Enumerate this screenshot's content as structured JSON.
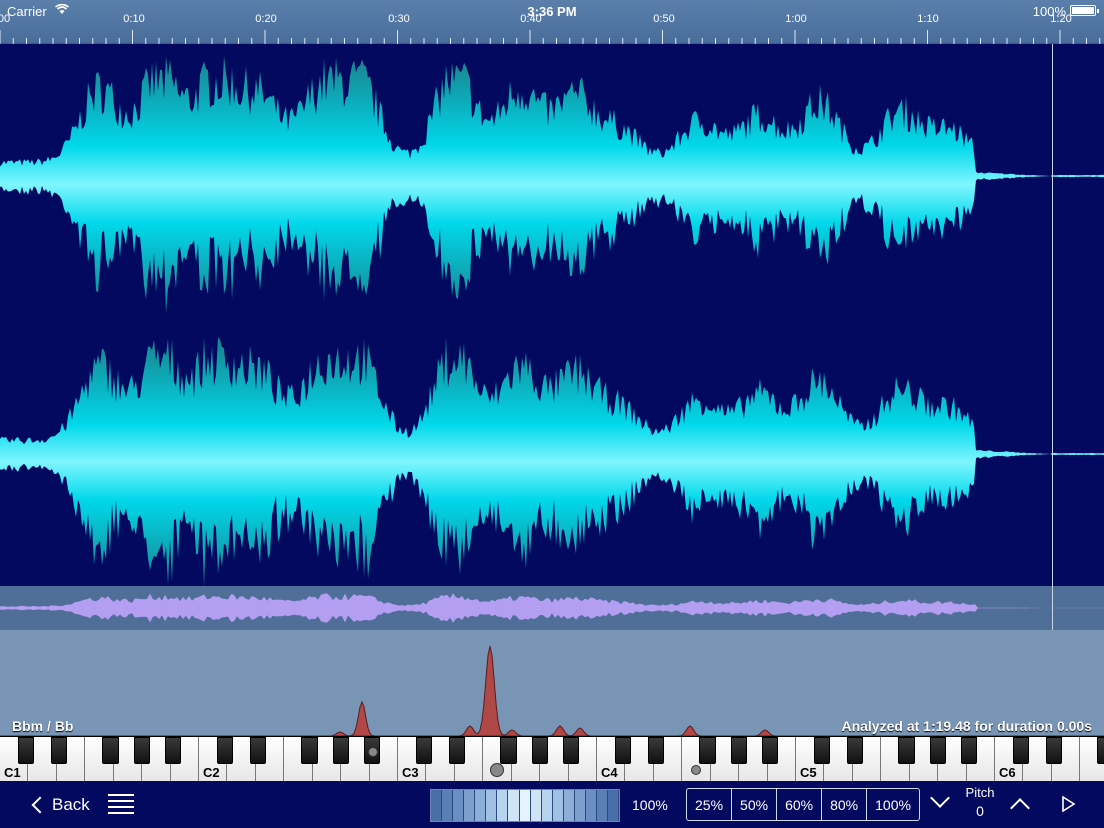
{
  "status_bar": {
    "carrier": "Carrier",
    "time": "3:36 PM",
    "battery": "100%"
  },
  "timeline": {
    "start_label": "00",
    "labels": [
      "0:10",
      "0:20",
      "0:30",
      "0:40",
      "0:50",
      "1:00",
      "1:10",
      "1:20"
    ]
  },
  "analyzer": {
    "chord": "Bbm / Bb",
    "status": "Analyzed at 1:19.48 for duration 0.00s"
  },
  "keyboard": {
    "octaves": [
      "C1",
      "C2",
      "C3",
      "C4",
      "C5",
      "C6"
    ]
  },
  "toolbar": {
    "back_label": "Back",
    "speed_value": "100%",
    "speed_presets": [
      "25%",
      "50%",
      "60%",
      "80%",
      "100%"
    ],
    "pitch_label": "Pitch",
    "pitch_value": "0"
  },
  "colors": {
    "background": "#02095f",
    "waveform": "#00e5f5",
    "overview": "#b39ef2",
    "spectrum_peak": "#b04848"
  },
  "icons": [
    "wifi-icon",
    "battery-icon",
    "back-chevron-icon",
    "list-icon",
    "pitch-down-icon",
    "pitch-up-icon",
    "play-icon"
  ]
}
